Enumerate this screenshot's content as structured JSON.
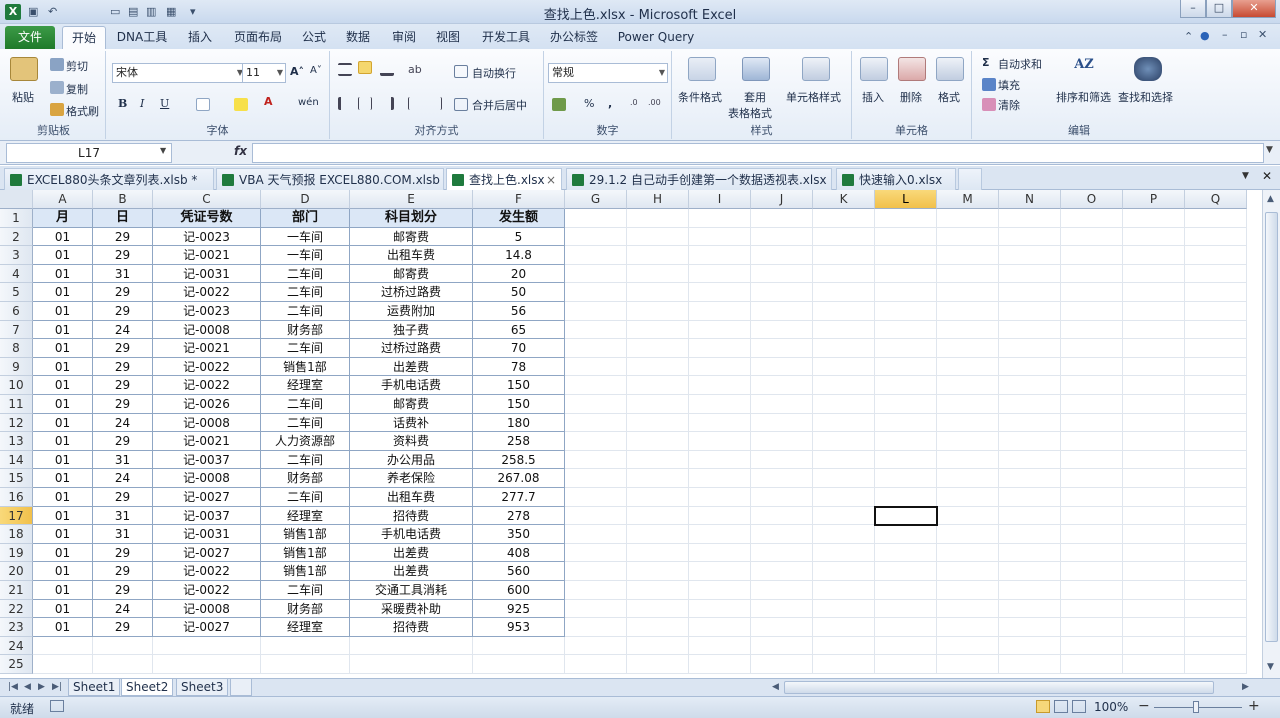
{
  "window": {
    "title": "查找上色.xlsx - Microsoft Excel",
    "min": "–",
    "max": "□",
    "close": "✕"
  },
  "app_icon": "X",
  "ribbon_tabs": [
    {
      "label": "文件"
    },
    {
      "label": "开始"
    },
    {
      "label": "DNA工具"
    },
    {
      "label": "插入"
    },
    {
      "label": "页面布局"
    },
    {
      "label": "公式"
    },
    {
      "label": "数据"
    },
    {
      "label": "审阅"
    },
    {
      "label": "视图"
    },
    {
      "label": "开发工具"
    },
    {
      "label": "办公标签"
    },
    {
      "label": "Power Query"
    }
  ],
  "clipboard": {
    "label": "剪贴板",
    "paste": "粘贴",
    "cut": "剪切",
    "copy": "复制",
    "format_painter": "格式刷"
  },
  "font": {
    "label": "字体",
    "name": "宋体",
    "size": "11",
    "bold": "B",
    "italic": "I",
    "underline": "U",
    "grow": "A˄",
    "shrink": "A˅",
    "font_color": "A",
    "phonetic": "wén"
  },
  "alignment": {
    "label": "对齐方式",
    "wrap": "自动换行",
    "merge": "合并后居中"
  },
  "number": {
    "label": "数字",
    "format": "常规",
    "percent": "%",
    "comma": ","
  },
  "styles": {
    "label": "样式",
    "conditional": "条件格式",
    "table_1": "套用",
    "table_2": "表格格式",
    "cell_styles": "单元格样式"
  },
  "cells": {
    "label": "单元格",
    "insert": "插入",
    "delete": "删除",
    "format": "格式"
  },
  "editing": {
    "label": "编辑",
    "autosum": "自动求和",
    "fill": "填充",
    "clear": "清除",
    "sort": "排序和筛选",
    "find": "查找和选择",
    "sigma": "Σ"
  },
  "formula_bar": {
    "name_box": "L17",
    "fx": "fx",
    "value": ""
  },
  "doc_tabs": [
    {
      "label": "EXCEL880头条文章列表.xlsb *"
    },
    {
      "label": "VBA 天气预报 EXCEL880.COM.xlsb"
    },
    {
      "label": "查找上色.xlsx",
      "close": "×"
    },
    {
      "label": "29.1.2 自己动手创建第一个数据透视表.xlsx"
    },
    {
      "label": "快速输入0.xlsx"
    }
  ],
  "columns": [
    "A",
    "B",
    "C",
    "D",
    "E",
    "F",
    "G",
    "H",
    "I",
    "J",
    "K",
    "L",
    "M",
    "N",
    "O",
    "P",
    "Q"
  ],
  "selected_column": "L",
  "selected_row": 17,
  "row_numbers": [
    "1",
    "2",
    "3",
    "4",
    "5",
    "6",
    "7",
    "8",
    "9",
    "10",
    "11",
    "12",
    "13",
    "14",
    "15",
    "16",
    "17",
    "18",
    "19",
    "20",
    "21",
    "22",
    "23",
    "24",
    "25"
  ],
  "table": {
    "headers": [
      "月",
      "日",
      "凭证号数",
      "部门",
      "科目划分",
      "发生额"
    ],
    "rows": [
      [
        "01",
        "29",
        "记-0023",
        "一车间",
        "邮寄费",
        "5"
      ],
      [
        "01",
        "29",
        "记-0021",
        "一车间",
        "出租车费",
        "14.8"
      ],
      [
        "01",
        "31",
        "记-0031",
        "二车间",
        "邮寄费",
        "20"
      ],
      [
        "01",
        "29",
        "记-0022",
        "二车间",
        "过桥过路费",
        "50"
      ],
      [
        "01",
        "29",
        "记-0023",
        "二车间",
        "运费附加",
        "56"
      ],
      [
        "01",
        "24",
        "记-0008",
        "财务部",
        "独子费",
        "65"
      ],
      [
        "01",
        "29",
        "记-0021",
        "二车间",
        "过桥过路费",
        "70"
      ],
      [
        "01",
        "29",
        "记-0022",
        "销售1部",
        "出差费",
        "78"
      ],
      [
        "01",
        "29",
        "记-0022",
        "经理室",
        "手机电话费",
        "150"
      ],
      [
        "01",
        "29",
        "记-0026",
        "二车间",
        "邮寄费",
        "150"
      ],
      [
        "01",
        "24",
        "记-0008",
        "二车间",
        "话费补",
        "180"
      ],
      [
        "01",
        "29",
        "记-0021",
        "人力资源部",
        "资料费",
        "258"
      ],
      [
        "01",
        "31",
        "记-0037",
        "二车间",
        "办公用品",
        "258.5"
      ],
      [
        "01",
        "24",
        "记-0008",
        "财务部",
        "养老保险",
        "267.08"
      ],
      [
        "01",
        "29",
        "记-0027",
        "二车间",
        "出租车费",
        "277.7"
      ],
      [
        "01",
        "31",
        "记-0037",
        "经理室",
        "招待费",
        "278"
      ],
      [
        "01",
        "31",
        "记-0031",
        "销售1部",
        "手机电话费",
        "350"
      ],
      [
        "01",
        "29",
        "记-0027",
        "销售1部",
        "出差费",
        "408"
      ],
      [
        "01",
        "29",
        "记-0022",
        "销售1部",
        "出差费",
        "560"
      ],
      [
        "01",
        "29",
        "记-0022",
        "二车间",
        "交通工具消耗",
        "600"
      ],
      [
        "01",
        "24",
        "记-0008",
        "财务部",
        "采暖费补助",
        "925"
      ],
      [
        "01",
        "29",
        "记-0027",
        "经理室",
        "招待费",
        "953"
      ]
    ]
  },
  "sheets": [
    {
      "label": "Sheet1"
    },
    {
      "label": "Sheet2",
      "active": true
    },
    {
      "label": "Sheet3"
    }
  ],
  "status": {
    "ready": "就绪",
    "zoom": "100%",
    "minus": "−",
    "plus": "+"
  },
  "colors": {
    "accent": "#1f7a3d",
    "header_fill": "#dbe7f6",
    "selection": "#f1c04b"
  }
}
